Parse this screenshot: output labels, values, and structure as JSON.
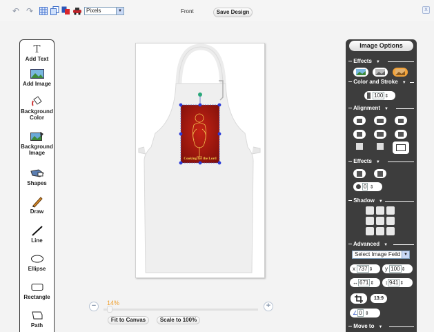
{
  "toolbar": {
    "icons": [
      "undo-icon",
      "redo-icon",
      "grid-icon",
      "copy-icon",
      "layers-icon",
      "car-icon"
    ],
    "units": "Pixels",
    "side": "Front",
    "save_label": "Save Design",
    "close_glyph": "X"
  },
  "tools": [
    {
      "label": "Add Text",
      "icon": "text-icon"
    },
    {
      "label": "Add Image",
      "icon": "image-icon"
    },
    {
      "label": "Background Color",
      "icon": "paint-bucket-icon"
    },
    {
      "label": "Background Image",
      "icon": "background-image-icon"
    },
    {
      "label": "Shapes",
      "icon": "shapes-icon"
    },
    {
      "label": "Draw",
      "icon": "pencil-icon"
    },
    {
      "label": "Line",
      "icon": "line-icon"
    },
    {
      "label": "Ellipse",
      "icon": "ellipse-icon"
    },
    {
      "label": "Rectangle",
      "icon": "rectangle-icon"
    },
    {
      "label": "Path",
      "icon": "path-icon"
    }
  ],
  "canvas": {
    "design_caption": "Cooking for the Lord",
    "product": "apron"
  },
  "zoom": {
    "percent": "14%",
    "level": 0.14,
    "fit_label": "Fit to Canvas",
    "scale_label": "Scale to 100%"
  },
  "options": {
    "title": "Image Options",
    "sections": {
      "effects": "Effects",
      "color_stroke": "Color and Stroke",
      "alignment": "Alignment",
      "effects2": "Effects",
      "shadow": "Shadow",
      "advanced": "Advanced",
      "move_to": "Move to"
    },
    "stroke_value": "100",
    "effect_value": "0",
    "select_field": "Select Image Feild",
    "x_label": "x",
    "x_value": "737",
    "y_label": "y",
    "y_value": "100",
    "w_value": "671",
    "h_value": "941",
    "ratio_label": "13:9",
    "rotate_value": "0"
  },
  "colors": {
    "panel_dark": "#3d3d3d",
    "accent_orange": "#f0a030",
    "design_red": "#b01a10",
    "handle_blue": "#2a3bd8"
  }
}
